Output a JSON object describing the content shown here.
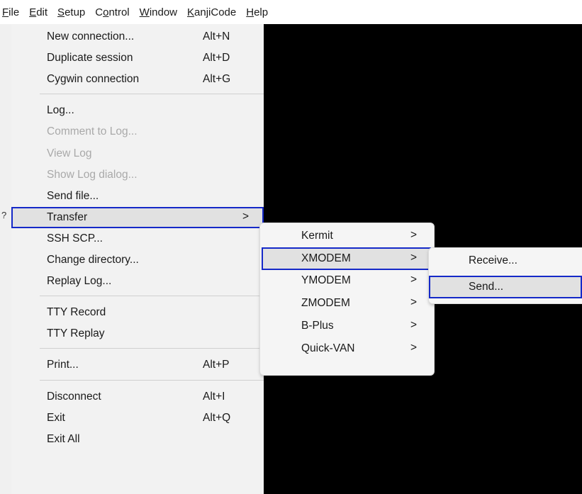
{
  "menubar": {
    "items": [
      {
        "name": "menu-file",
        "prefix": "",
        "key": "F",
        "rest": "ile"
      },
      {
        "name": "menu-edit",
        "prefix": "",
        "key": "E",
        "rest": "dit"
      },
      {
        "name": "menu-setup",
        "prefix": "",
        "key": "S",
        "rest": "etup"
      },
      {
        "name": "menu-control",
        "prefix": "C",
        "key": "o",
        "rest": "ntrol"
      },
      {
        "name": "menu-window",
        "prefix": "",
        "key": "W",
        "rest": "indow"
      },
      {
        "name": "menu-kanjicode",
        "prefix": "",
        "key": "K",
        "rest": "anjiCode"
      },
      {
        "name": "menu-help",
        "prefix": "",
        "key": "H",
        "rest": "elp"
      }
    ]
  },
  "file_menu": {
    "groups": [
      [
        {
          "label": "New connection...",
          "accel": "Alt+N"
        },
        {
          "label": "Duplicate session",
          "accel": "Alt+D"
        },
        {
          "label": "Cygwin connection",
          "accel": "Alt+G"
        }
      ],
      [
        {
          "label": "Log..."
        },
        {
          "label": "Comment to Log...",
          "disabled": true
        },
        {
          "label": "View Log",
          "disabled": true
        },
        {
          "label": "Show Log dialog...",
          "disabled": true
        },
        {
          "label": "Send file..."
        },
        {
          "label": "Transfer",
          "submenu": true,
          "highlighted": true
        },
        {
          "label": "SSH SCP..."
        },
        {
          "label": "Change directory..."
        },
        {
          "label": "Replay Log..."
        }
      ],
      [
        {
          "label": "TTY Record"
        },
        {
          "label": "TTY Replay"
        }
      ],
      [
        {
          "label": "Print...",
          "accel": "Alt+P"
        }
      ],
      [
        {
          "label": "Disconnect",
          "accel": "Alt+I"
        },
        {
          "label": "Exit",
          "accel": "Alt+Q"
        },
        {
          "label": "Exit All"
        }
      ]
    ]
  },
  "transfer_submenu": {
    "items": [
      {
        "label": "Kermit"
      },
      {
        "label": "XMODEM",
        "highlighted": true
      },
      {
        "label": "YMODEM"
      },
      {
        "label": "ZMODEM"
      },
      {
        "label": "B-Plus"
      },
      {
        "label": "Quick-VAN"
      }
    ]
  },
  "xmodem_submenu": {
    "items": [
      {
        "label": "Receive..."
      },
      {
        "label": "Send...",
        "highlighted": true
      }
    ]
  },
  "arrow_glyph": ">",
  "left_glyph": "?",
  "colors": {
    "highlight_outline": "#1529c8",
    "highlight_fill": "#e1e1e1",
    "terminal_bg": "#000000",
    "disabled_text": "#a9a9a9"
  }
}
